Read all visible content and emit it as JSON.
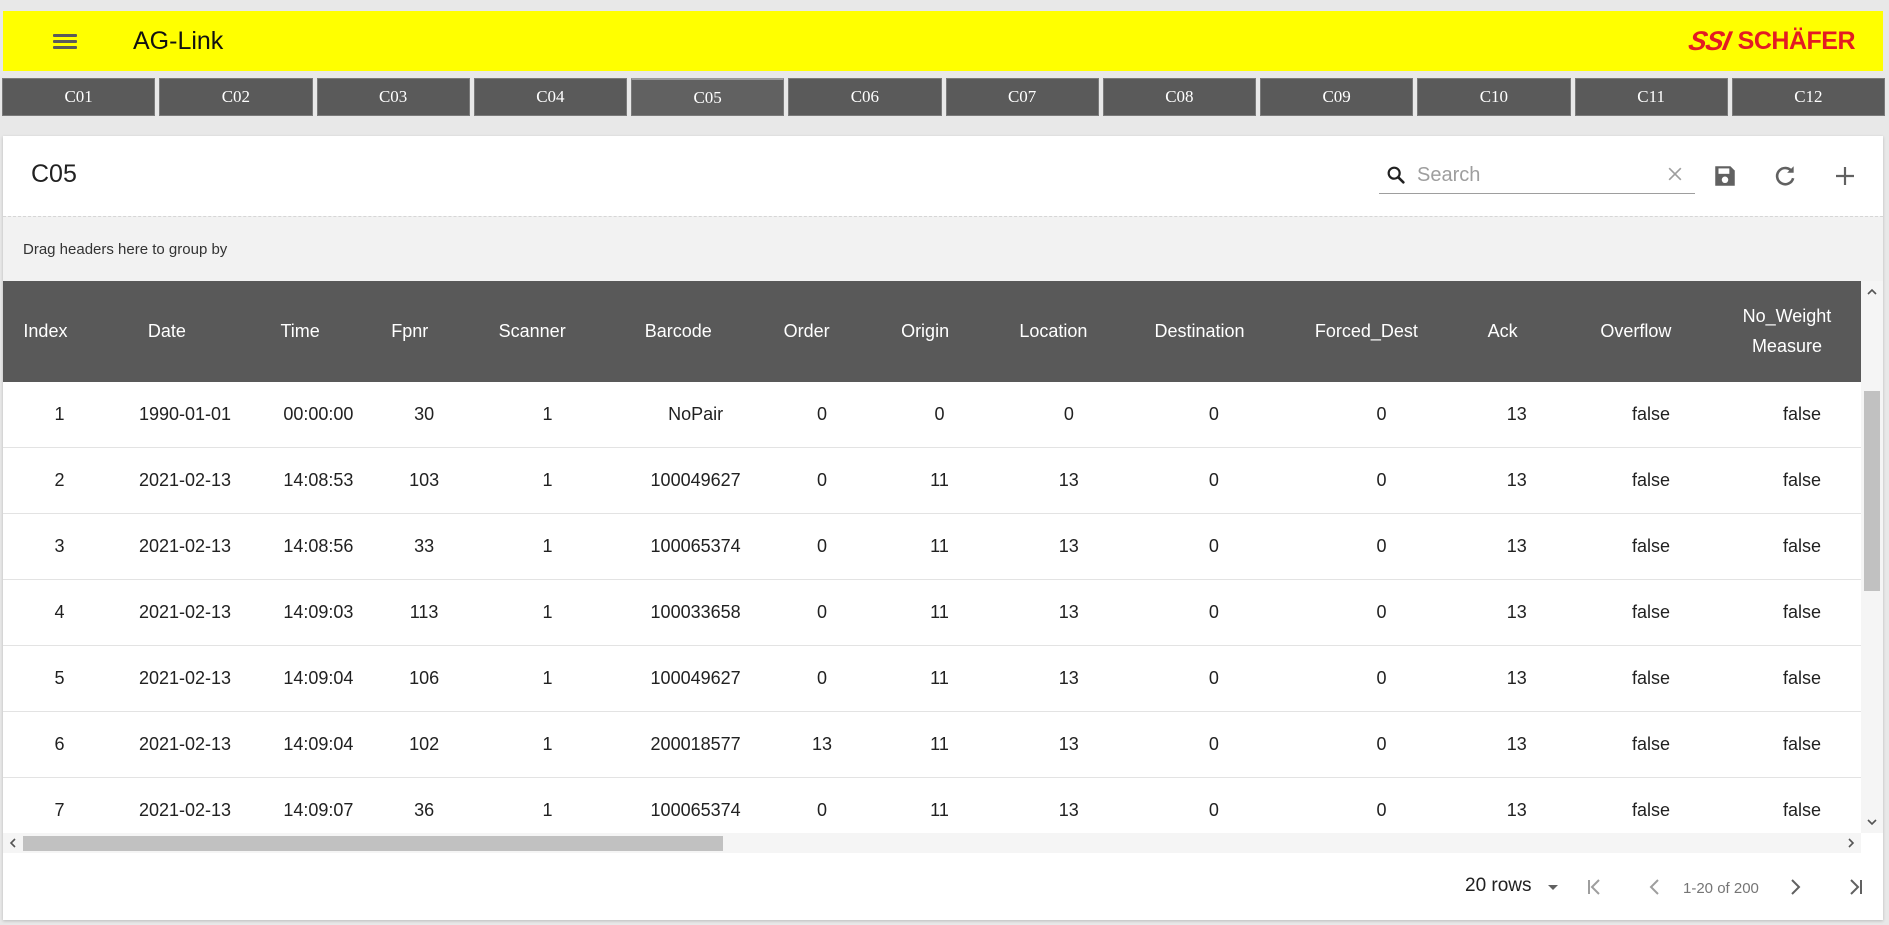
{
  "app": {
    "title": "AG-Link",
    "logo_ssi": "SSI",
    "logo_brand": "SCHÄFER",
    "brand_color": "#e31b23",
    "header_color": "#ffff00"
  },
  "icons": {
    "menu": "menu-icon",
    "search": "search-icon",
    "clear": "close-icon",
    "save": "save-icon",
    "refresh": "refresh-icon",
    "add": "add-icon"
  },
  "tabs": [
    {
      "label": "C01"
    },
    {
      "label": "C02"
    },
    {
      "label": "C03"
    },
    {
      "label": "C04"
    },
    {
      "label": "C05",
      "active": true
    },
    {
      "label": "C06"
    },
    {
      "label": "C07"
    },
    {
      "label": "C08"
    },
    {
      "label": "C09"
    },
    {
      "label": "C10"
    },
    {
      "label": "C11"
    },
    {
      "label": "C12"
    }
  ],
  "card": {
    "title": "C05",
    "search_placeholder": "Search",
    "search_value": "",
    "group_hint": "Drag headers here to group by"
  },
  "grid": {
    "columns": [
      "Index",
      "Date",
      "Time",
      "Fpnr",
      "Scanner",
      "Barcode",
      "Order",
      "Origin",
      "Location",
      "Destination",
      "Forced_Dest",
      "Ack",
      "Overflow",
      "No_Weight Measure"
    ],
    "rows": [
      [
        "1",
        "1990-01-01",
        "00:00:00",
        "30",
        "1",
        "NoPair",
        "0",
        "0",
        "0",
        "0",
        "0",
        "13",
        "false",
        "false"
      ],
      [
        "2",
        "2021-02-13",
        "14:08:53",
        "103",
        "1",
        "100049627",
        "0",
        "11",
        "13",
        "0",
        "0",
        "13",
        "false",
        "false"
      ],
      [
        "3",
        "2021-02-13",
        "14:08:56",
        "33",
        "1",
        "100065374",
        "0",
        "11",
        "13",
        "0",
        "0",
        "13",
        "false",
        "false"
      ],
      [
        "4",
        "2021-02-13",
        "14:09:03",
        "113",
        "1",
        "100033658",
        "0",
        "11",
        "13",
        "0",
        "0",
        "13",
        "false",
        "false"
      ],
      [
        "5",
        "2021-02-13",
        "14:09:04",
        "106",
        "1",
        "100049627",
        "0",
        "11",
        "13",
        "0",
        "0",
        "13",
        "false",
        "false"
      ],
      [
        "6",
        "2021-02-13",
        "14:09:04",
        "102",
        "1",
        "200018577",
        "13",
        "11",
        "13",
        "0",
        "0",
        "13",
        "false",
        "false"
      ],
      [
        "7",
        "2021-02-13",
        "14:09:07",
        "36",
        "1",
        "100065374",
        "0",
        "11",
        "13",
        "0",
        "0",
        "13",
        "false",
        "false"
      ]
    ]
  },
  "pager": {
    "rows_label": "20 rows",
    "info": "1-20 of 200"
  }
}
